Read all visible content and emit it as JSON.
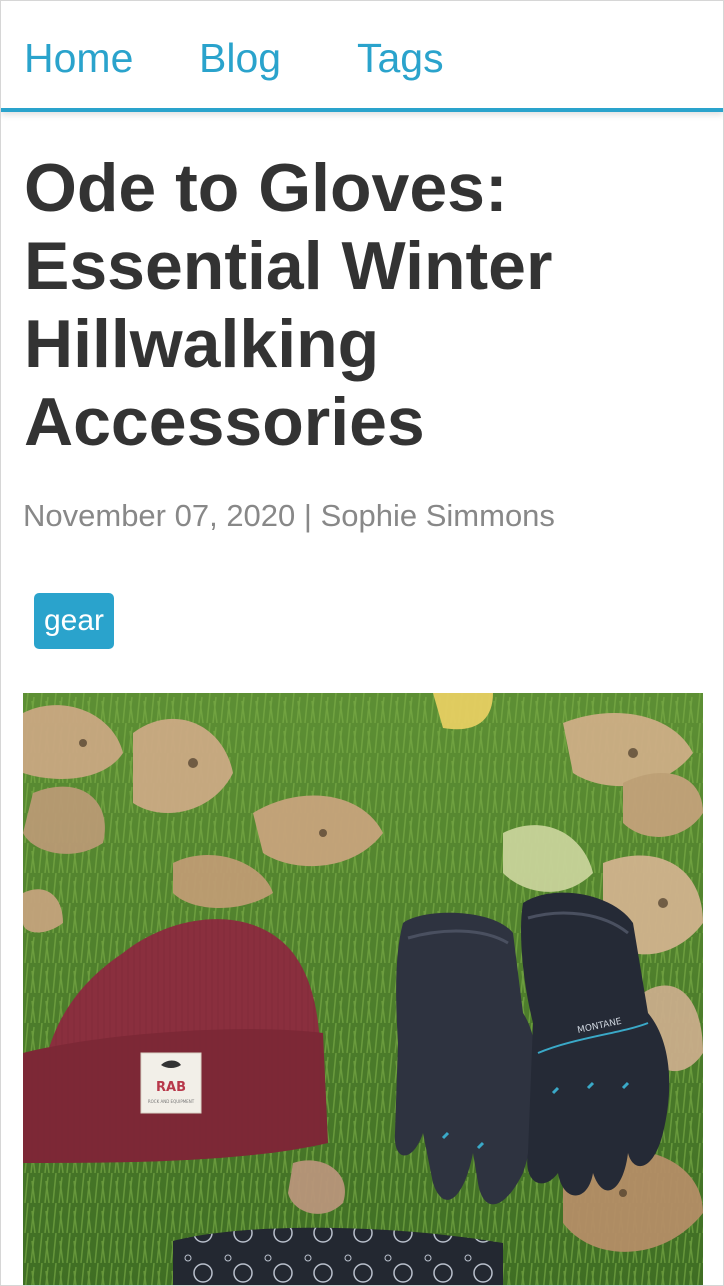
{
  "nav": {
    "items": [
      {
        "label": "Home"
      },
      {
        "label": "Blog"
      },
      {
        "label": "Tags"
      }
    ]
  },
  "post": {
    "title": "Ode to Gloves: Essential Winter Hillwalking Accessories",
    "date": "November 07, 2020",
    "separator": "|",
    "author": "Sophie Simmons",
    "tags": [
      "gear"
    ]
  },
  "hero_image": {
    "description_icon": "photo-hat-gloves",
    "hat_label": "RAB",
    "hat_sub_label": "ROCK AND EQUIPMENT",
    "glove_brand": "MONTANE"
  },
  "colors": {
    "accent": "#2aa3cc",
    "title": "#333333",
    "meta": "#888888"
  }
}
